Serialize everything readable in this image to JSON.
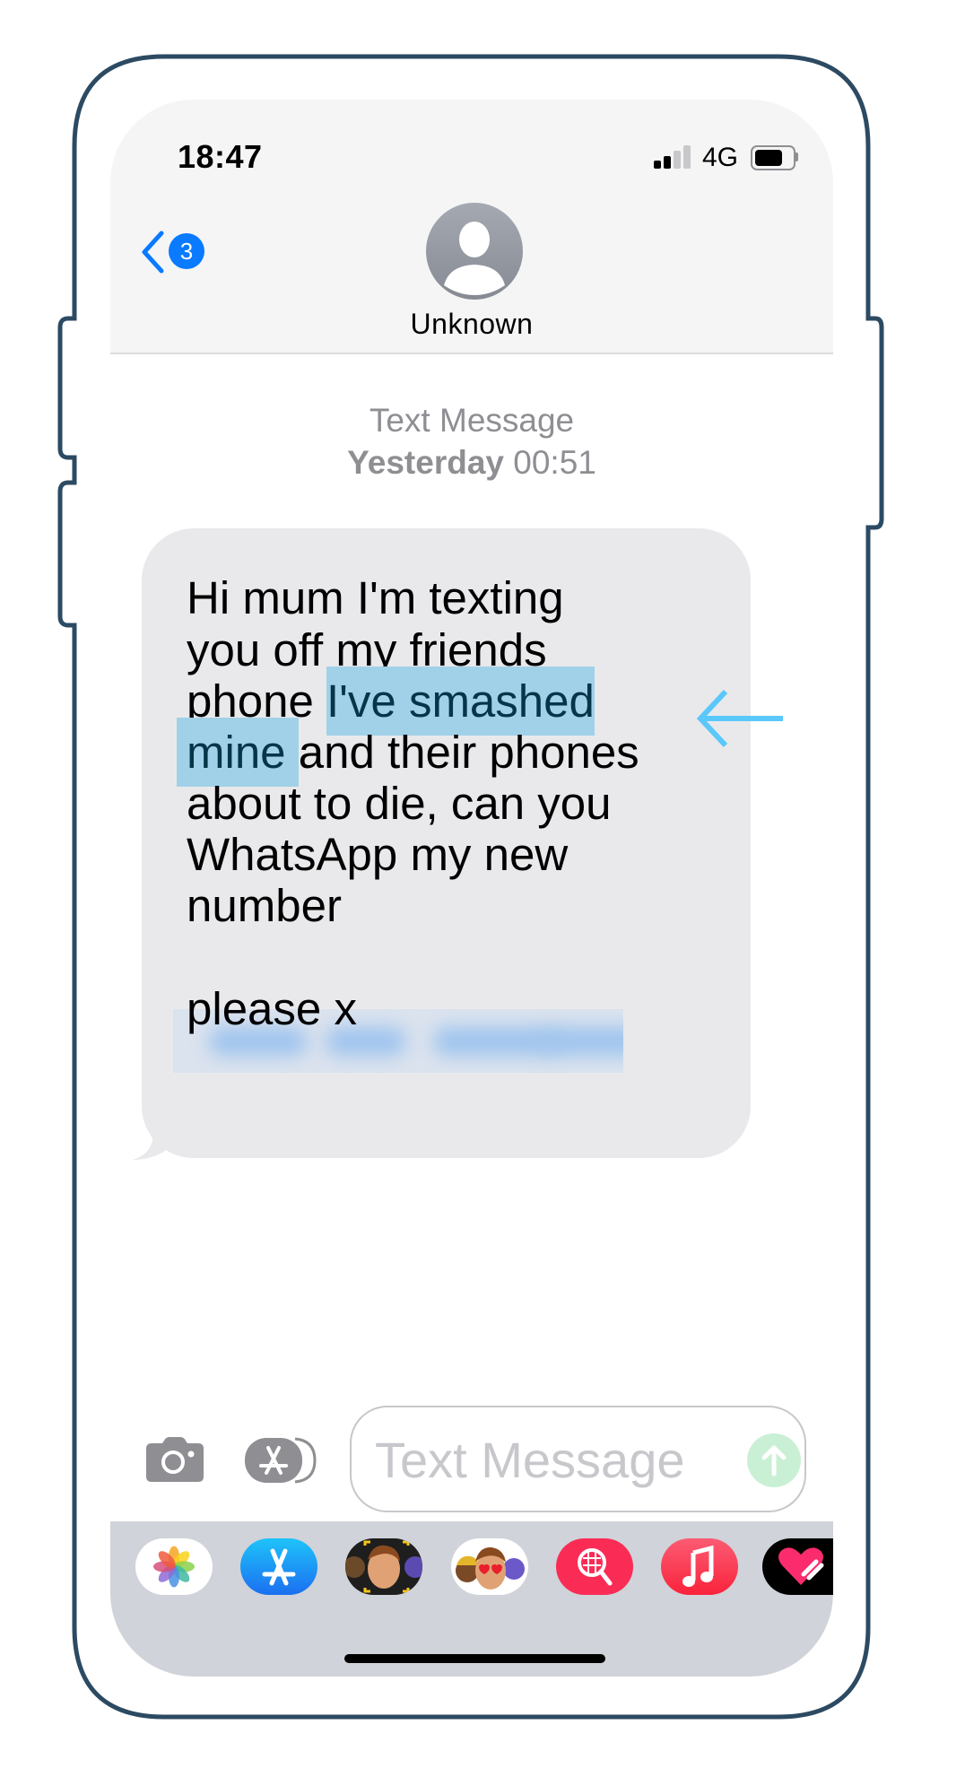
{
  "status_bar": {
    "time": "18:47",
    "network": "4G",
    "signal_bars_total": 4,
    "signal_bars_active": 2,
    "battery_level": 0.75
  },
  "header": {
    "back_icon": "chevron-left-icon",
    "unread_count": "3",
    "avatar_icon": "person-silhouette-icon",
    "contact_name": "Unknown"
  },
  "conversation": {
    "service_label": "Text Message",
    "timestamp_day": "Yesterday",
    "timestamp_time": "00:51",
    "message": {
      "lines": [
        [
          {
            "text": "Hi mum I'm texting",
            "highlight": false
          }
        ],
        [
          {
            "text": "you off my friends",
            "highlight": false
          }
        ],
        [
          {
            "text": "phone ",
            "highlight": false
          },
          {
            "text": " I've smashed ",
            "highlight": true
          }
        ],
        [
          {
            "text": "mine ",
            "highlight": true
          },
          {
            "text": "and their phones",
            "highlight": false
          }
        ],
        [
          {
            "text": "about to die, can you",
            "highlight": false
          }
        ],
        [
          {
            "text": "WhatsApp my new",
            "highlight": false
          }
        ],
        [
          {
            "text": "number",
            "highlight": false
          }
        ],
        [
          {
            "text": "",
            "redacted": true
          }
        ],
        [
          {
            "text": "please x",
            "highlight": false
          }
        ]
      ],
      "redacted_phone_number": true
    },
    "annotation_arrow_icon": "arrow-left-icon"
  },
  "compose": {
    "camera_icon": "camera-icon",
    "apps_icon": "app-store-icon",
    "placeholder": "Text Message",
    "send_icon": "arrow-up-icon"
  },
  "app_drawer": {
    "apps": [
      {
        "name": "Photos",
        "icon": "photos-icon"
      },
      {
        "name": "App Store",
        "icon": "app-store-icon"
      },
      {
        "name": "Memoji Stickers",
        "icon": "memoji-icon"
      },
      {
        "name": "Animoji",
        "icon": "animoji-icon"
      },
      {
        "name": "Search Images",
        "icon": "image-search-icon"
      },
      {
        "name": "Music",
        "icon": "music-icon"
      },
      {
        "name": "Digital Touch",
        "icon": "digital-touch-icon"
      }
    ]
  },
  "colors": {
    "accent_blue": "#0a7aff",
    "highlight": "#a1d1e8",
    "annotation_arrow": "#5ac8fa",
    "bubble_gray": "#e9e9eb",
    "send_green_disabled": "#c9f0d4"
  }
}
